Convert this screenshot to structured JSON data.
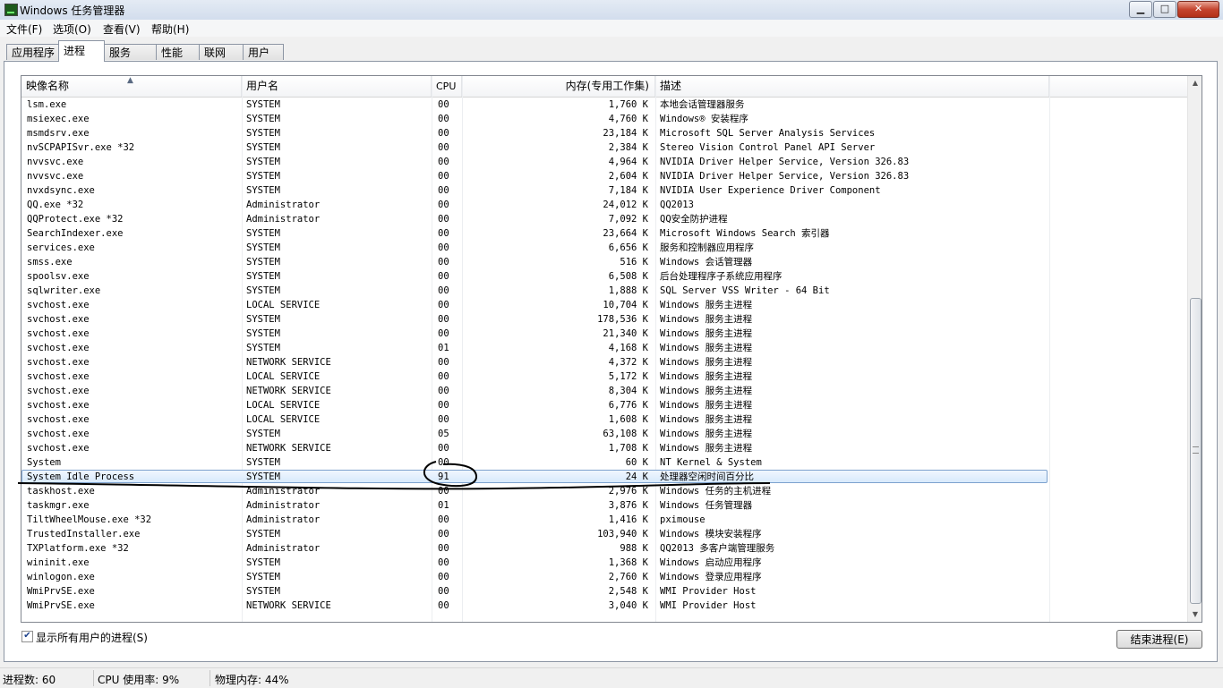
{
  "window": {
    "title": "Windows 任务管理器",
    "min_glyph": "▁",
    "max_glyph": "□",
    "close_glyph": "✕"
  },
  "menu": [
    "文件(F)",
    "选项(O)",
    "查看(V)",
    "帮助(H)"
  ],
  "tabs": [
    "应用程序",
    "进程",
    "服务",
    "性能",
    "联网",
    "用户"
  ],
  "active_tab": "进程",
  "columns": {
    "name": "映像名称",
    "user": "用户名",
    "cpu": "CPU",
    "mem": "内存(专用工作集)",
    "desc": "描述"
  },
  "processes": [
    {
      "name": "lsm.exe",
      "user": "SYSTEM",
      "cpu": "00",
      "mem": "1,760 K",
      "desc": "本地会话管理器服务"
    },
    {
      "name": "msiexec.exe",
      "user": "SYSTEM",
      "cpu": "00",
      "mem": "4,760 K",
      "desc": "Windows® 安装程序"
    },
    {
      "name": "msmdsrv.exe",
      "user": "SYSTEM",
      "cpu": "00",
      "mem": "23,184 K",
      "desc": "Microsoft SQL Server Analysis Services"
    },
    {
      "name": "nvSCPAPISvr.exe *32",
      "user": "SYSTEM",
      "cpu": "00",
      "mem": "2,384 K",
      "desc": "Stereo Vision Control Panel API Server"
    },
    {
      "name": "nvvsvc.exe",
      "user": "SYSTEM",
      "cpu": "00",
      "mem": "4,964 K",
      "desc": "NVIDIA Driver Helper Service, Version 326.83"
    },
    {
      "name": "nvvsvc.exe",
      "user": "SYSTEM",
      "cpu": "00",
      "mem": "2,604 K",
      "desc": "NVIDIA Driver Helper Service, Version 326.83"
    },
    {
      "name": "nvxdsync.exe",
      "user": "SYSTEM",
      "cpu": "00",
      "mem": "7,184 K",
      "desc": "NVIDIA User Experience Driver Component"
    },
    {
      "name": "QQ.exe *32",
      "user": "Administrator",
      "cpu": "00",
      "mem": "24,012 K",
      "desc": "QQ2013"
    },
    {
      "name": "QQProtect.exe *32",
      "user": "Administrator",
      "cpu": "00",
      "mem": "7,092 K",
      "desc": "QQ安全防护进程"
    },
    {
      "name": "SearchIndexer.exe",
      "user": "SYSTEM",
      "cpu": "00",
      "mem": "23,664 K",
      "desc": "Microsoft Windows Search 索引器"
    },
    {
      "name": "services.exe",
      "user": "SYSTEM",
      "cpu": "00",
      "mem": "6,656 K",
      "desc": "服务和控制器应用程序"
    },
    {
      "name": "smss.exe",
      "user": "SYSTEM",
      "cpu": "00",
      "mem": "516 K",
      "desc": "Windows 会话管理器"
    },
    {
      "name": "spoolsv.exe",
      "user": "SYSTEM",
      "cpu": "00",
      "mem": "6,508 K",
      "desc": "后台处理程序子系统应用程序"
    },
    {
      "name": "sqlwriter.exe",
      "user": "SYSTEM",
      "cpu": "00",
      "mem": "1,888 K",
      "desc": "SQL Server VSS Writer - 64 Bit"
    },
    {
      "name": "svchost.exe",
      "user": "LOCAL SERVICE",
      "cpu": "00",
      "mem": "10,704 K",
      "desc": "Windows 服务主进程"
    },
    {
      "name": "svchost.exe",
      "user": "SYSTEM",
      "cpu": "00",
      "mem": "178,536 K",
      "desc": "Windows 服务主进程"
    },
    {
      "name": "svchost.exe",
      "user": "SYSTEM",
      "cpu": "00",
      "mem": "21,340 K",
      "desc": "Windows 服务主进程"
    },
    {
      "name": "svchost.exe",
      "user": "SYSTEM",
      "cpu": "01",
      "mem": "4,168 K",
      "desc": "Windows 服务主进程"
    },
    {
      "name": "svchost.exe",
      "user": "NETWORK SERVICE",
      "cpu": "00",
      "mem": "4,372 K",
      "desc": "Windows 服务主进程"
    },
    {
      "name": "svchost.exe",
      "user": "LOCAL SERVICE",
      "cpu": "00",
      "mem": "5,172 K",
      "desc": "Windows 服务主进程"
    },
    {
      "name": "svchost.exe",
      "user": "NETWORK SERVICE",
      "cpu": "00",
      "mem": "8,304 K",
      "desc": "Windows 服务主进程"
    },
    {
      "name": "svchost.exe",
      "user": "LOCAL SERVICE",
      "cpu": "00",
      "mem": "6,776 K",
      "desc": "Windows 服务主进程"
    },
    {
      "name": "svchost.exe",
      "user": "LOCAL SERVICE",
      "cpu": "00",
      "mem": "1,608 K",
      "desc": "Windows 服务主进程"
    },
    {
      "name": "svchost.exe",
      "user": "SYSTEM",
      "cpu": "05",
      "mem": "63,108 K",
      "desc": "Windows 服务主进程"
    },
    {
      "name": "svchost.exe",
      "user": "NETWORK SERVICE",
      "cpu": "00",
      "mem": "1,708 K",
      "desc": "Windows 服务主进程"
    },
    {
      "name": "System",
      "user": "SYSTEM",
      "cpu": "00",
      "mem": "60 K",
      "desc": "NT Kernel & System"
    },
    {
      "name": "System Idle Process",
      "user": "SYSTEM",
      "cpu": "91",
      "mem": "24 K",
      "desc": "处理器空闲时间百分比",
      "selected": true
    },
    {
      "name": "taskhost.exe",
      "user": "Administrator",
      "cpu": "00",
      "mem": "2,976 K",
      "desc": "Windows 任务的主机进程"
    },
    {
      "name": "taskmgr.exe",
      "user": "Administrator",
      "cpu": "01",
      "mem": "3,876 K",
      "desc": "Windows 任务管理器"
    },
    {
      "name": "TiltWheelMouse.exe *32",
      "user": "Administrator",
      "cpu": "00",
      "mem": "1,416 K",
      "desc": "pximouse"
    },
    {
      "name": "TrustedInstaller.exe",
      "user": "SYSTEM",
      "cpu": "00",
      "mem": "103,940 K",
      "desc": "Windows 模块安装程序"
    },
    {
      "name": "TXPlatform.exe *32",
      "user": "Administrator",
      "cpu": "00",
      "mem": "988 K",
      "desc": "QQ2013 多客户端管理服务"
    },
    {
      "name": "wininit.exe",
      "user": "SYSTEM",
      "cpu": "00",
      "mem": "1,368 K",
      "desc": "Windows 启动应用程序"
    },
    {
      "name": "winlogon.exe",
      "user": "SYSTEM",
      "cpu": "00",
      "mem": "2,760 K",
      "desc": "Windows 登录应用程序"
    },
    {
      "name": "WmiPrvSE.exe",
      "user": "SYSTEM",
      "cpu": "00",
      "mem": "2,548 K",
      "desc": "WMI Provider Host"
    },
    {
      "name": "WmiPrvSE.exe",
      "user": "NETWORK SERVICE",
      "cpu": "00",
      "mem": "3,040 K",
      "desc": "WMI Provider Host"
    }
  ],
  "show_all_label": "显示所有用户的进程(S)",
  "show_all_checked": true,
  "end_process_label": "结束进程(E)",
  "status": {
    "processes": "进程数: 60",
    "cpu": "CPU 使用率: 9%",
    "memory": "物理内存: 44%"
  },
  "icons": {
    "sort": "sort-ascending-icon",
    "check": "checkmark-icon",
    "app": "task-manager-icon"
  }
}
